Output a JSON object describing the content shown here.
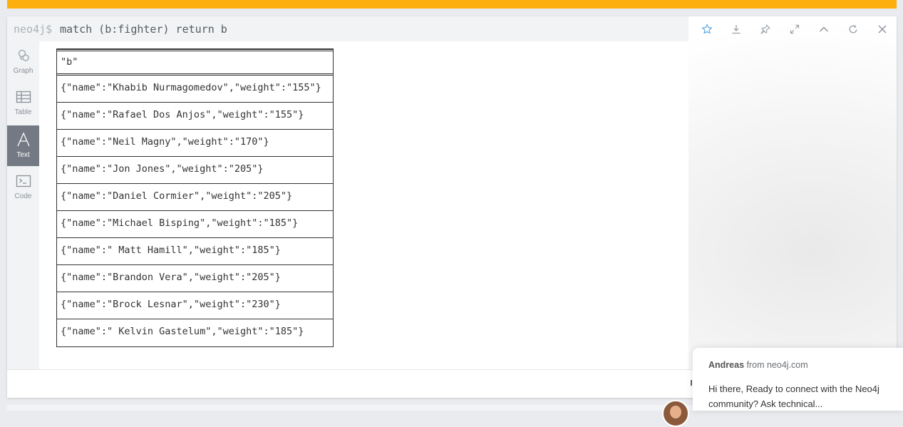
{
  "editor": {
    "prompt": "neo4j$",
    "query": "match (b:fighter) return b"
  },
  "frame_actions": [
    "star-icon",
    "download-icon",
    "pin-icon",
    "expand-icon",
    "collapse-icon",
    "refresh-icon",
    "close-icon"
  ],
  "views": [
    {
      "label": "Graph",
      "icon": "graph-icon"
    },
    {
      "label": "Table",
      "icon": "table-icon"
    },
    {
      "label": "Text",
      "icon": "text-icon",
      "active": true
    },
    {
      "label": "Code",
      "icon": "code-icon"
    }
  ],
  "result": {
    "header": "\"b\"",
    "rows": [
      "{\"name\":\"Khabib Nurmagomedov\",\"weight\":\"155\"}",
      "{\"name\":\"Rafael Dos Anjos\",\"weight\":\"155\"}",
      "{\"name\":\"Neil Magny\",\"weight\":\"170\"}",
      "{\"name\":\"Jon Jones\",\"weight\":\"205\"}",
      "{\"name\":\"Daniel Cormier\",\"weight\":\"205\"}",
      "{\"name\":\"Michael Bisping\",\"weight\":\"185\"}",
      "{\"name\":\" Matt Hamill\",\"weight\":\"185\"}",
      "{\"name\":\"Brandon Vera\",\"weight\":\"205\"}",
      "{\"name\":\"Brock Lesnar\",\"weight\":\"230\"}",
      "{\"name\":\" Kelvin Gastelum\",\"weight\":\"185\"}"
    ]
  },
  "chat": {
    "sender": "Andreas",
    "from_text": "from neo4j.com",
    "message": "Hi there, Ready to connect with the Neo4j community?  Ask technical..."
  },
  "colors": {
    "accent_bar": "#fdb00d",
    "active_view": "#737a83",
    "star": "#5aa9e6"
  }
}
